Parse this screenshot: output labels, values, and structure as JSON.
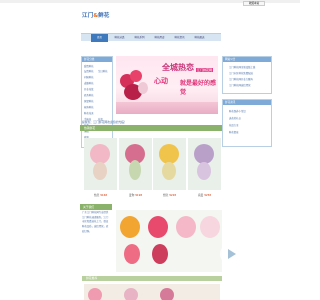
{
  "top": {
    "favorite_button": "收藏本站"
  },
  "logo": {
    "left": "江门",
    "amp": "&",
    "right": "鲜花"
  },
  "nav": {
    "items": [
      "首页",
      "鲜花分类",
      "鲜花系列",
      "鲜花用途",
      "鲜花资讯",
      "鲜花配送"
    ]
  },
  "left_box": {
    "title": "鲜花分类",
    "rows": [
      [
        "爱情鲜花",
        ""
      ],
      [
        "友情鲜花",
        "生日鲜花"
      ],
      [
        "问候鲜花",
        ""
      ],
      [
        "道歉鲜花",
        ""
      ],
      [
        "开业花篮",
        ""
      ],
      [
        "商务鲜花",
        ""
      ],
      [
        "探望鲜花",
        ""
      ],
      [
        "祝寿鲜花",
        ""
      ],
      [
        "鲜花花束",
        ""
      ],
      [
        "手捧花",
        "花篮"
      ],
      [
        "花盒",
        ""
      ],
      [
        "绿植",
        ""
      ],
      [
        "玫瑰",
        ""
      ],
      [
        "百合",
        ""
      ],
      [
        "康乃馨",
        ""
      ]
    ]
  },
  "banner": {
    "headline_1": "全城热恋",
    "badge": "江门鲜花网",
    "headline_2": "心动",
    "headline_3": "就是最好的感觉"
  },
  "right_box_1": {
    "title": "网站公告",
    "items": [
      "江门鲜花网全新改版上线",
      "江门市区鲜花免费配送",
      "江门鲜花网开业大酬宾",
      "江门鲜花网诚信经营"
    ]
  },
  "right_box_2": {
    "title": "鲜花资讯",
    "items": [
      "鲜花保养小常识",
      "送花的礼仪",
      "花语大全",
      "鲜花寓意"
    ]
  },
  "notice": "提醒您：江门鲜花网欢迎您的光临！",
  "hot_section": {
    "title": "热销鲜花"
  },
  "products": [
    {
      "name": "热恋",
      "price": "¥168"
    },
    {
      "name": "爱你",
      "price": "¥198"
    },
    {
      "name": "想念",
      "price": "¥228"
    },
    {
      "name": "真爱",
      "price": "¥258"
    }
  ],
  "about": {
    "title": "关于我们",
    "text": "广东江门鲜花网专业提供江门鲜花速递服务，江门市区免费送花上门，保证鲜花品质，诚信经营，欢迎订购。"
  },
  "bottom_bar": {
    "title": "鲜花推荐"
  },
  "watermark": {
    "text": "酷数据",
    "sub": "KUIDC"
  }
}
